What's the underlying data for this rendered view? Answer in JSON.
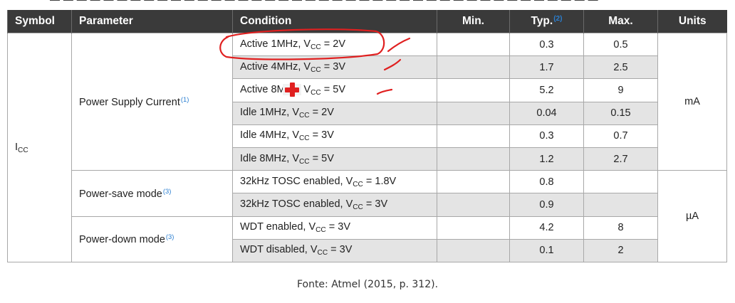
{
  "header": {
    "symbol": "Symbol",
    "parameter": "Parameter",
    "condition": "Condition",
    "min": "Min.",
    "typ": "Typ.",
    "typ_note": "(2)",
    "max": "Max.",
    "units": "Units"
  },
  "symbol": {
    "main": "I",
    "sub": "CC"
  },
  "groups": [
    {
      "parameter": "Power Supply Current",
      "note": "(1)",
      "units": "mA"
    },
    {
      "parameter": "Power-save mode",
      "note": "(3)",
      "units": "µA"
    },
    {
      "parameter": "Power-down mode",
      "note": "(3)"
    }
  ],
  "rows": [
    {
      "cond_pre": "Active 1MHz, V",
      "cond_sub": "CC",
      "cond_post": " = 2V",
      "min": "",
      "typ": "0.3",
      "max": "0.5"
    },
    {
      "cond_pre": "Active 4MHz, V",
      "cond_sub": "CC",
      "cond_post": " = 3V",
      "min": "",
      "typ": "1.7",
      "max": "2.5"
    },
    {
      "cond_pre": "Active 8MHz, V",
      "cond_sub": "CC",
      "cond_post": " = 5V",
      "min": "",
      "typ": "5.2",
      "max": "9"
    },
    {
      "cond_pre": "Idle 1MHz, V",
      "cond_sub": "CC",
      "cond_post": " = 2V",
      "min": "",
      "typ": "0.04",
      "max": "0.15"
    },
    {
      "cond_pre": "Idle 4MHz, V",
      "cond_sub": "CC",
      "cond_post": " = 3V",
      "min": "",
      "typ": "0.3",
      "max": "0.7"
    },
    {
      "cond_pre": "Idle 8MHz, V",
      "cond_sub": "CC",
      "cond_post": " = 5V",
      "min": "",
      "typ": "1.2",
      "max": "2.7"
    },
    {
      "cond_pre": "32kHz TOSC enabled, V",
      "cond_sub": "CC",
      "cond_post": " = 1.8V",
      "min": "",
      "typ": "0.8",
      "max": ""
    },
    {
      "cond_pre": "32kHz TOSC enabled, V",
      "cond_sub": "CC",
      "cond_post": " = 3V",
      "min": "",
      "typ": "0.9",
      "max": ""
    },
    {
      "cond_pre": "WDT enabled, V",
      "cond_sub": "CC",
      "cond_post": " = 3V",
      "min": "",
      "typ": "4.2",
      "max": "8"
    },
    {
      "cond_pre": "WDT disabled, V",
      "cond_sub": "CC",
      "cond_post": " = 3V",
      "min": "",
      "typ": "0.1",
      "max": "2"
    }
  ],
  "caption": "Fonte: Atmel (2015, p. 312).",
  "colors": {
    "header_bg": "#3a3a3a",
    "shade": "#e4e4e4",
    "ink": "#e02020",
    "note": "#2b7fd1"
  },
  "cursor_icon": "red-plus-cursor"
}
